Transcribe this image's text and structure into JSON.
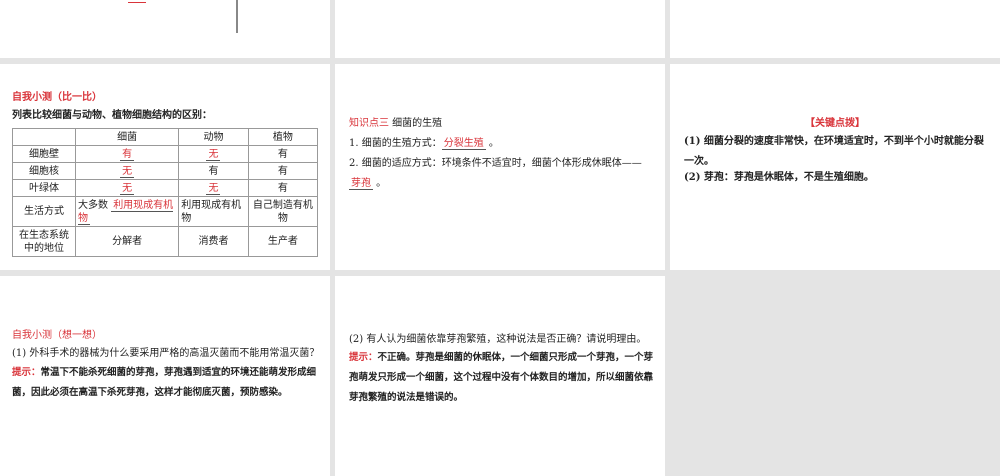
{
  "slide1": {
    "partial_label": "……"
  },
  "slide4": {
    "title": "自我小测（比一比）",
    "subtitle": "列表比较细菌与动物、植物细胞结构的区别：",
    "headers": [
      "",
      "细菌",
      "动物",
      "植物"
    ],
    "rows": [
      [
        "细胞壁",
        "有",
        "无",
        "有"
      ],
      [
        "细胞核",
        "无",
        "有",
        "有"
      ],
      [
        "叶绿体",
        "无",
        "无",
        "有"
      ],
      [
        "生活方式",
        "大多数 利用现成有机物",
        "利用现成有机物",
        "自己制造有机物"
      ],
      [
        "在生态系统中的地位",
        "分解者",
        "消费者",
        "生产者"
      ]
    ],
    "life_prefix": "大多数 ",
    "life_answer": "利用现成有机物"
  },
  "slide5": {
    "heading_red": "知识点三",
    "heading": " 细菌的生殖",
    "l1_pre": "1. 细菌的生殖方式：",
    "l1_ans": "分裂生殖",
    "l1_post": " 。",
    "l2_pre": "2. 细菌的适应方式：环境条件不适宜时，细菌个体形成休眠体——",
    "l2_ans": "芽孢",
    "l2_post": " 。"
  },
  "slide6": {
    "title": "【关键点拨】",
    "p1": "(1) 细菌分裂的速度非常快，在环境适宜时，不到半个小时就能分裂一次。",
    "p2": "(2) 芽孢：芽孢是休眠体，不是生殖细胞。"
  },
  "slide7": {
    "title": "自我小测（想一想）",
    "q": "(1) 外科手术的器械为什么要采用严格的高温灭菌而不能用常温灭菌？",
    "hint": "提示：",
    "a": "常温下不能杀死细菌的芽孢，芽孢遇到适宜的环境还能萌发形成细菌，因此必须在高温下杀死芽孢，这样才能彻底灭菌，预防感染。"
  },
  "slide8": {
    "q": "(2) 有人认为细菌依靠芽孢繁殖，这种说法是否正确？请说明理由。",
    "hint": "提示：",
    "a": "不正确。芽孢是细菌的休眠体，一个细菌只形成一个芽孢，一个芽孢萌发只形成一个细菌，这个过程中没有个体数目的增加，所以细菌依靠芽孢繁殖的说法是错误的。"
  }
}
